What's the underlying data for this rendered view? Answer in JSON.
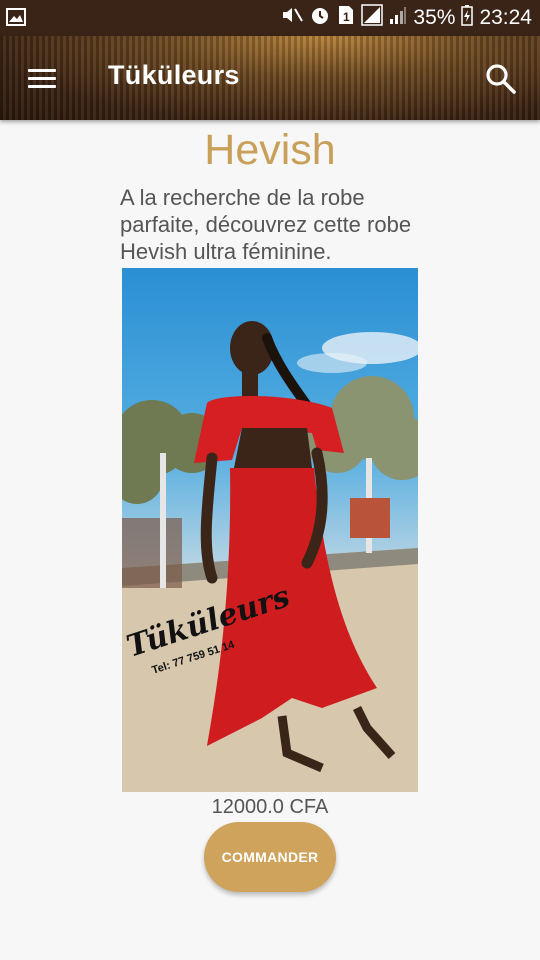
{
  "status_bar": {
    "battery": "35%",
    "time": "23:24",
    "sim_slot": "1",
    "icons": [
      "gallery-icon",
      "mute-icon",
      "alarm-icon",
      "sim-icon",
      "signal-icon",
      "signal-icon",
      "battery-icon"
    ]
  },
  "toolbar": {
    "title": "Tüküleurs",
    "menu_icon": "menu-icon",
    "search_icon": "search-icon"
  },
  "product": {
    "name": "Hevish",
    "description": "A la recherche de la robe parfaite, découvrez cette robe Hevish ultra féminine.",
    "image": {
      "watermark_brand": "Tüküleurs",
      "watermark_phone": "Tel: 77 759 51 14"
    },
    "price": "12000.0 CFA",
    "order_label": "COMMANDER"
  },
  "colors": {
    "accent_gold": "#cfa35c",
    "title_gold": "#c9a05a",
    "toolbar_brown": "#3a2212"
  }
}
